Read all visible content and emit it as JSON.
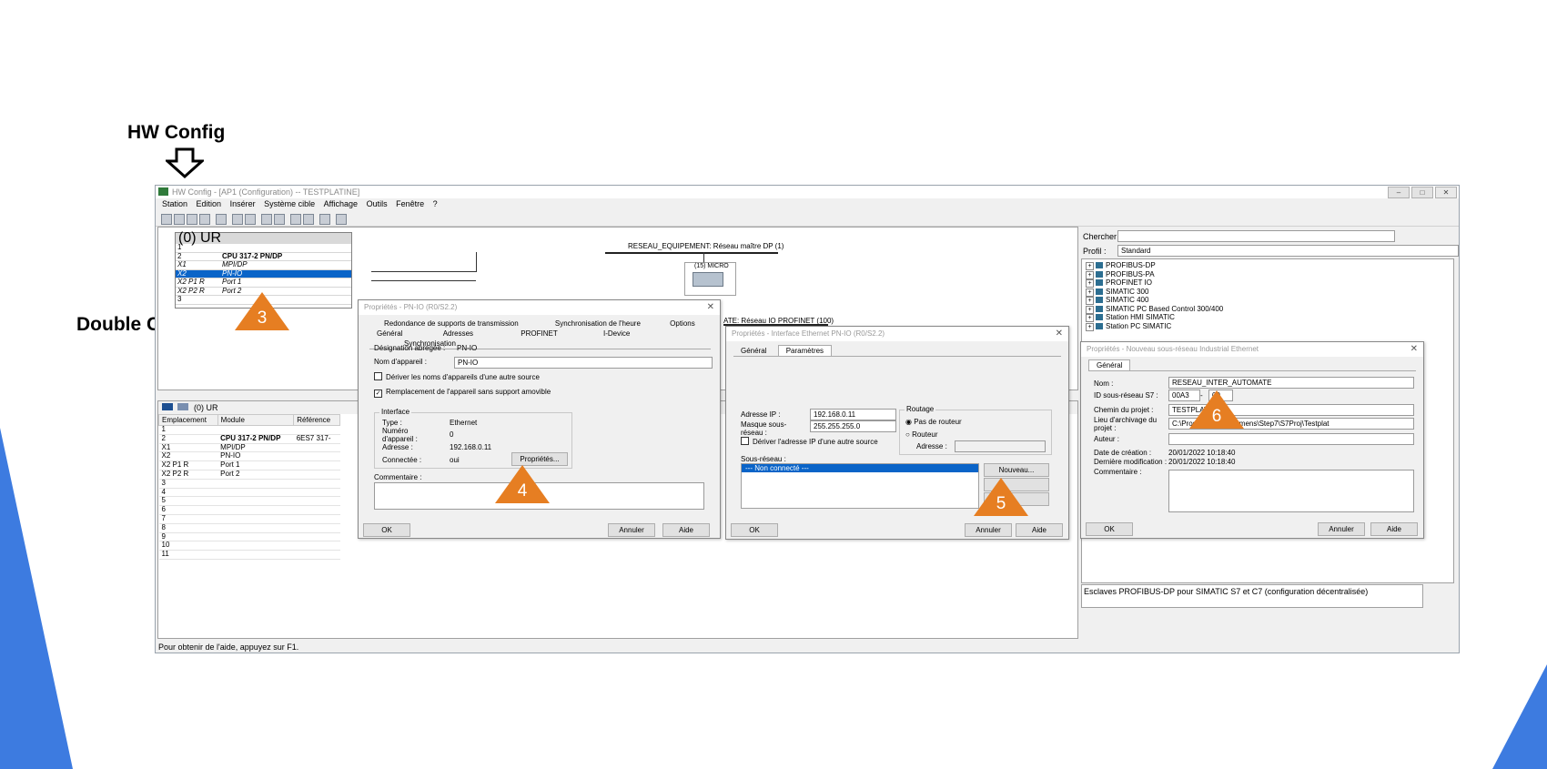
{
  "slide": {
    "title": "HW Config",
    "double_click_label": "Double Clic"
  },
  "window": {
    "title": "HW Config - [AP1 (Configuration) -- TESTPLATINE]",
    "menu": [
      "Station",
      "Edition",
      "Insérer",
      "Système cible",
      "Affichage",
      "Outils",
      "Fenêtre",
      "?"
    ],
    "status": "Pour obtenir de l'aide, appuyez sur F1."
  },
  "rack": {
    "title": "(0) UR",
    "rows": [
      {
        "slot": "1",
        "module": ""
      },
      {
        "slot": "2",
        "module": "CPU 317-2 PN/DP"
      },
      {
        "slot": "X1",
        "module": "MPI/DP"
      },
      {
        "slot": "X2",
        "module": "PN-IO"
      },
      {
        "slot": "X2 P1 R",
        "module": "Port 1"
      },
      {
        "slot": "X2 P2 R",
        "module": "Port 2"
      },
      {
        "slot": "3",
        "module": ""
      }
    ]
  },
  "network": {
    "dp_label": "RESEAU_EQUIPEMENT: Réseau maître DP (1)",
    "dp_device": "(15) MICRO",
    "pn_label": "ATE: Réseau IO PROFINET (100)"
  },
  "lower_table": {
    "title": "(0) UR",
    "headers": [
      "Emplacement",
      "Module",
      "Référence"
    ],
    "rows": [
      [
        "1",
        "",
        ""
      ],
      [
        "2",
        "CPU 317-2 PN/DP",
        "6ES7 317-"
      ],
      [
        "X1",
        "MPI/DP",
        ""
      ],
      [
        "X2",
        "PN-IO",
        ""
      ],
      [
        "X2 P1 R",
        "Port 1",
        ""
      ],
      [
        "X2 P2 R",
        "Port 2",
        ""
      ],
      [
        "3",
        "",
        ""
      ],
      [
        "4",
        "",
        ""
      ],
      [
        "5",
        "",
        ""
      ],
      [
        "6",
        "",
        ""
      ],
      [
        "7",
        "",
        ""
      ],
      [
        "8",
        "",
        ""
      ],
      [
        "9",
        "",
        ""
      ],
      [
        "10",
        "",
        ""
      ],
      [
        "11",
        "",
        ""
      ]
    ]
  },
  "catalog": {
    "search_label": "Chercher :",
    "profile_label": "Profil :",
    "profile_value": "Standard",
    "items": [
      "PROFIBUS-DP",
      "PROFIBUS-PA",
      "PROFINET IO",
      "SIMATIC 300",
      "SIMATIC 400",
      "SIMATIC PC Based Control 300/400",
      "Station HMI SIMATIC",
      "Station PC SIMATIC"
    ],
    "info": "Esclaves PROFIBUS-DP pour SIMATIC S7 et C7 (configuration décentralisée)"
  },
  "dlg_pnio": {
    "title": "Propriétés - PN-IO (R0/S2.2)",
    "tabs_top": [
      "Redondance de supports de transmission",
      "Synchronisation de l'heure",
      "Options"
    ],
    "tabs_bottom": [
      "Général",
      "Adresses",
      "PROFINET",
      "I-Device",
      "Synchronisation"
    ],
    "short_name_label": "Désignation abrégée :",
    "short_name_value": "PN-IO",
    "device_name_label": "Nom d'appareil :",
    "device_name_value": "PN-IO",
    "chk1": "Dériver les noms d'appareils d'une autre source",
    "chk2": "Remplacement de l'appareil sans support amovible",
    "interface_title": "Interface",
    "type_label": "Type :",
    "type_value": "Ethernet",
    "num_label": "Numéro d'appareil :",
    "num_value": "0",
    "addr_label": "Adresse :",
    "addr_value": "192.168.0.11",
    "connected_label": "Connectée :",
    "connected_value": "oui",
    "props_btn": "Propriétés...",
    "comment_label": "Commentaire :",
    "ok": "OK",
    "cancel": "Annuler",
    "help": "Aide"
  },
  "dlg_eth": {
    "title": "Propriétés - Interface Ethernet PN-IO (R0/S2.2)",
    "tabs": [
      "Général",
      "Paramètres"
    ],
    "ip_label": "Adresse IP :",
    "ip_value": "192.168.0.11",
    "mask_label": "Masque sous-réseau :",
    "mask_value": "255.255.255.0",
    "chk": "Dériver l'adresse IP d'une autre source",
    "routing_title": "Routage",
    "no_router": "Pas de routeur",
    "router": "Routeur",
    "router_addr_label": "Adresse :",
    "subnet_label": "Sous-réseau :",
    "subnet_item": "--- Non connecté ---",
    "new_btn": "Nouveau...",
    "ok": "OK",
    "cancel": "Annuler",
    "help": "Aide"
  },
  "dlg_subnet": {
    "title": "Propriétés - Nouveau sous-réseau Industrial Ethernet",
    "tab": "Général",
    "name_label": "Nom :",
    "name_value": "RESEAU_INTER_AUTOMATE",
    "id_label": "ID sous-réseau S7 :",
    "id_value1": "00A3",
    "id_value2": "00",
    "path_label": "Chemin du projet :",
    "path_value": "TESTPLAT",
    "archive_label": "Lieu d'archivage du projet :",
    "archive_value": "C:\\Program Files\\Siemens\\Step7\\S7Proj\\Testplat",
    "author_label": "Auteur :",
    "created_label": "Date de création :",
    "created_value": "20/01/2022 10:18:40",
    "modified_label": "Dernière modification :",
    "modified_value": "20/01/2022 10:18:40",
    "comment_label": "Commentaire :",
    "ok": "OK",
    "cancel": "Annuler",
    "help": "Aide"
  },
  "callouts": [
    "3",
    "4",
    "5",
    "6"
  ],
  "colors": {
    "callout": "#e67e22",
    "selection": "#0a64c8",
    "deco_blue": "#2f6fd6"
  }
}
